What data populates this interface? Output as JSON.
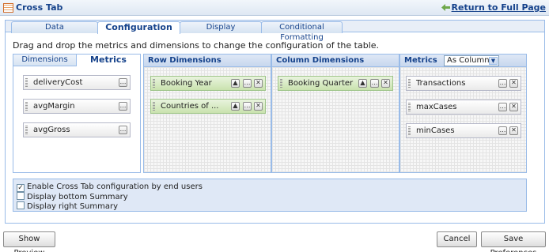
{
  "window": {
    "title": "Cross Tab",
    "return_link": "Return to Full Page"
  },
  "tabs": [
    {
      "label": "Data",
      "active": false
    },
    {
      "label": "Configuration",
      "active": true
    },
    {
      "label": "Display",
      "active": false
    },
    {
      "label": "Conditional Formatting",
      "active": false
    }
  ],
  "instructions": "Drag and drop the metrics and dimensions to change the configuration of the table.",
  "source_panel": {
    "tabs": [
      {
        "label": "Dimensions",
        "active": false
      },
      {
        "label": "Metrics",
        "active": true
      }
    ],
    "items": [
      "deliveryCost",
      "avgMargin",
      "avgGross"
    ]
  },
  "row_dimensions": {
    "header": "Row Dimensions",
    "items": [
      "Booking Year",
      "Countries of ..."
    ]
  },
  "column_dimensions": {
    "header": "Column Dimensions",
    "items": [
      "Booking Quarter"
    ]
  },
  "metrics": {
    "header": "Metrics",
    "display_mode": "As Columns",
    "items": [
      "Transactions",
      "maxCases",
      "minCases"
    ]
  },
  "options": [
    {
      "label": "Enable Cross Tab configuration by end users",
      "checked": true
    },
    {
      "label": "Display bottom Summary",
      "checked": false
    },
    {
      "label": "Display right Summary",
      "checked": false
    }
  ],
  "buttons": {
    "show_preview": "Show Preview",
    "cancel": "Cancel",
    "save": "Save Preferences"
  },
  "icons": {
    "more": "…",
    "remove": "✕",
    "up": "▲",
    "check": "✓",
    "dropdown": "▼"
  },
  "colors": {
    "accent": "#15428b",
    "border": "#99bbe8",
    "green_item": "#c9e2ae"
  }
}
